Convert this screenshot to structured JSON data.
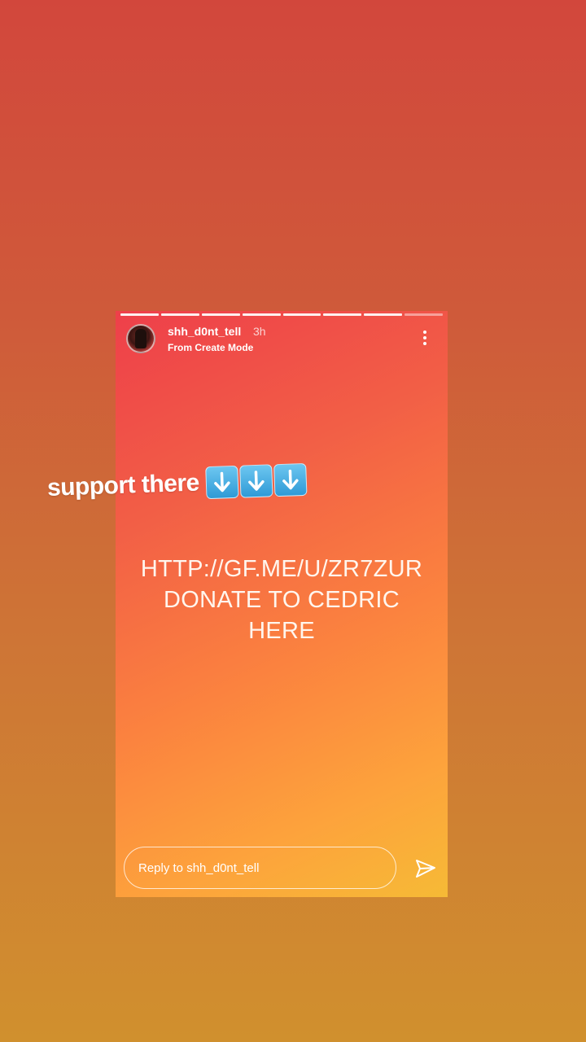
{
  "story": {
    "username": "shh_d0nt_tell",
    "time": "3h",
    "subtitle": "From Create Mode",
    "main_text_lines": [
      "HTTP://GF.ME/U/ZR7ZUR",
      "DONATE TO CEDRIC",
      "HERE"
    ],
    "progress_segments": 8,
    "active_segment": 8
  },
  "sticker": {
    "text": "support there",
    "emoji_icon": "down-arrow-emoji-icon",
    "emoji_count": 3
  },
  "reply": {
    "placeholder": "Reply to shh_d0nt_tell"
  },
  "icons": {
    "menu": "more-vertical-icon",
    "send": "send-icon"
  },
  "colors": {
    "background_top": "#d2473c",
    "background_bottom": "#d0902e",
    "story_gradient_start": "#ee3f4a",
    "story_gradient_end": "#f6ba36",
    "emoji_blue": "#2f9ad6"
  }
}
